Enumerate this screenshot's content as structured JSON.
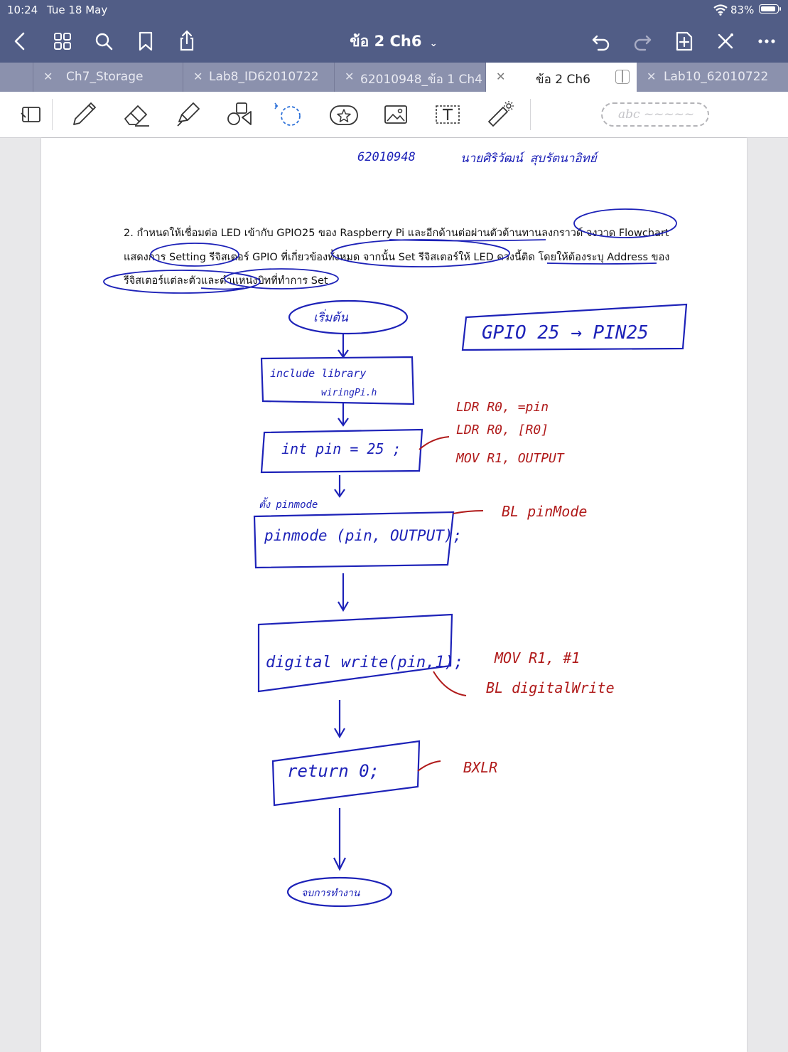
{
  "status_bar": {
    "time": "10:24",
    "date": "Tue 18 May",
    "battery": "83%"
  },
  "nav": {
    "title": "ข้อ 2 Ch6"
  },
  "tabs": [
    {
      "label": "Ch7_Storage"
    },
    {
      "label": "Lab8_ID62010722"
    },
    {
      "label": "62010948_ข้อ 1 Ch4"
    },
    {
      "label": "ข้อ 2 Ch6",
      "active": true
    },
    {
      "label": "Lab10_62010722"
    }
  ],
  "toolbar": {
    "handwriting_placeholder": "abc ~~~~~"
  },
  "note": {
    "student_id": "62010948",
    "student_name": "นายศิริวัฒน์ สุบรัตนาอิทย์",
    "question_lines": [
      "2. กำหนดให้เชื่อมต่อ LED เข้ากับ GPIO25 ของ Raspberry Pi และอีกด้านต่อผ่านตัวต้านทานลงกราวด์ จงวาด Flowchart",
      "แสดงการ Setting รีจิสเตอร์ GPIO ที่เกี่ยวข้องทั้งหมด จากนั้น Set รีจิสเตอร์ให้ LED ดวงนี้ติด  โดยให้ต้องระบุ Address ของ",
      "รีจิสเตอร์แต่ละตัวและตำแหน่งบิทที่ทำการ Set"
    ],
    "gpio_box": "GPIO 25 → PIN25",
    "flow": {
      "start": "เริ่มต้น",
      "include_1": "include  library",
      "include_2": "wiringPi.h",
      "int_pin": "int pin = 25 ;",
      "pinmode_label": "ตั้ง pinmode",
      "pinmode": "pinmode (pin, OUTPUT);",
      "digital_write": "digital write(pin,1);",
      "return": "return 0;",
      "end": "จบการทำงาน"
    },
    "asm": {
      "int_pin": [
        "LDR   R0, =pin",
        "LDR   R0, [R0]",
        "MOV   R1, OUTPUT"
      ],
      "pinmode": "BL  pinMode",
      "digital_write": [
        "MOV   R1, #1",
        "BL  digitalWrite"
      ],
      "return": "BXLR"
    }
  }
}
